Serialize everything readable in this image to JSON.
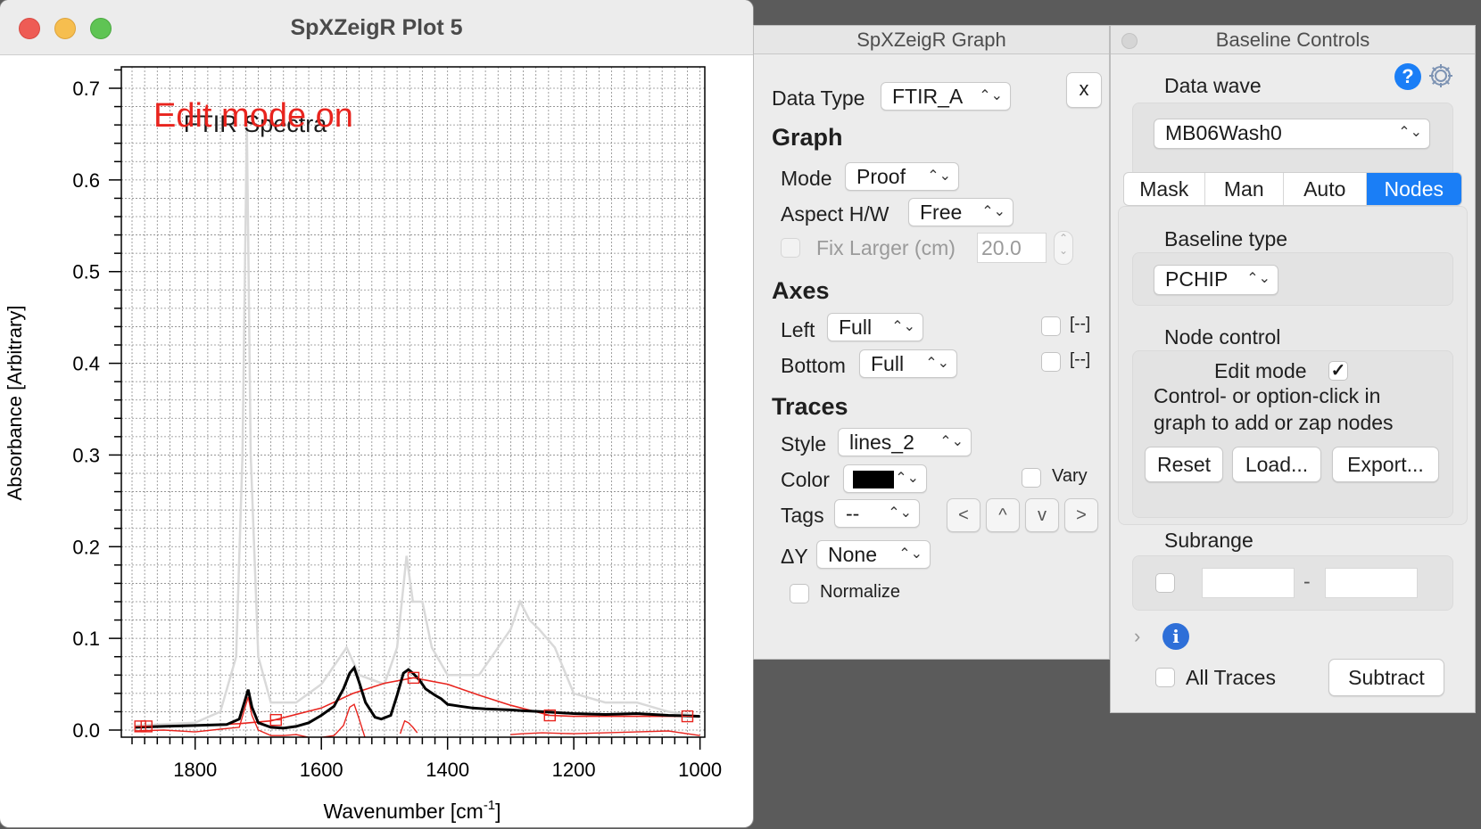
{
  "plot_window": {
    "title": "SpXZeigR Plot 5",
    "edit_mode_text": "Edit mode on",
    "plot_title": "FTIR Spectra",
    "colors": {
      "edit_text": "#e8241e",
      "trace": "#000000",
      "baseline": "#e8241e",
      "ghost": "#d9d9d9"
    },
    "chart_data": {
      "type": "line",
      "title": "FTIR Spectra",
      "xlabel": "Wavenumber [cm",
      "xlabel_sup": "-1",
      "xlabel_tail": "]",
      "ylabel": "Absorbance [Arbitrary]",
      "xlim": [
        1900,
        1000
      ],
      "ylim": [
        -0.01,
        0.72
      ],
      "x_reversed": true,
      "grid": true,
      "x_ticks": [
        "1800",
        "1600",
        "1400",
        "1200",
        "1000"
      ],
      "y_ticks": [
        "0.0",
        "0.1",
        "0.2",
        "0.3",
        "0.4",
        "0.5",
        "0.6",
        "0.7"
      ],
      "series": [
        {
          "role": "ghost",
          "points": [
            [
              1895,
              0.005
            ],
            [
              1800,
              0.008
            ],
            [
              1760,
              0.02
            ],
            [
              1735,
              0.08
            ],
            [
              1725,
              0.3
            ],
            [
              1718,
              0.66
            ],
            [
              1712,
              0.3
            ],
            [
              1700,
              0.08
            ],
            [
              1680,
              0.03
            ],
            [
              1640,
              0.03
            ],
            [
              1600,
              0.05
            ],
            [
              1560,
              0.09
            ],
            [
              1540,
              0.06
            ],
            [
              1500,
              0.05
            ],
            [
              1480,
              0.09
            ],
            [
              1465,
              0.19
            ],
            [
              1455,
              0.14
            ],
            [
              1440,
              0.14
            ],
            [
              1425,
              0.09
            ],
            [
              1400,
              0.06
            ],
            [
              1350,
              0.06
            ],
            [
              1300,
              0.11
            ],
            [
              1285,
              0.14
            ],
            [
              1270,
              0.12
            ],
            [
              1255,
              0.11
            ],
            [
              1230,
              0.09
            ],
            [
              1200,
              0.04
            ],
            [
              1150,
              0.03
            ],
            [
              1100,
              0.03
            ],
            [
              1050,
              0.02
            ],
            [
              1000,
              0.015
            ]
          ]
        },
        {
          "role": "trace",
          "points": [
            [
              1895,
              0.003
            ],
            [
              1850,
              0.004
            ],
            [
              1800,
              0.005
            ],
            [
              1750,
              0.006
            ],
            [
              1730,
              0.012
            ],
            [
              1722,
              0.03
            ],
            [
              1716,
              0.044
            ],
            [
              1710,
              0.025
            ],
            [
              1700,
              0.008
            ],
            [
              1680,
              0.003
            ],
            [
              1660,
              0.002
            ],
            [
              1640,
              0.004
            ],
            [
              1620,
              0.008
            ],
            [
              1600,
              0.016
            ],
            [
              1580,
              0.026
            ],
            [
              1565,
              0.045
            ],
            [
              1555,
              0.062
            ],
            [
              1548,
              0.068
            ],
            [
              1540,
              0.052
            ],
            [
              1530,
              0.03
            ],
            [
              1515,
              0.014
            ],
            [
              1505,
              0.012
            ],
            [
              1490,
              0.016
            ],
            [
              1480,
              0.038
            ],
            [
              1470,
              0.062
            ],
            [
              1462,
              0.066
            ],
            [
              1455,
              0.062
            ],
            [
              1445,
              0.055
            ],
            [
              1435,
              0.045
            ],
            [
              1420,
              0.038
            ],
            [
              1410,
              0.034
            ],
            [
              1400,
              0.028
            ],
            [
              1380,
              0.026
            ],
            [
              1360,
              0.024
            ],
            [
              1340,
              0.023
            ],
            [
              1300,
              0.022
            ],
            [
              1280,
              0.021
            ],
            [
              1250,
              0.02
            ],
            [
              1200,
              0.018
            ],
            [
              1150,
              0.017
            ],
            [
              1100,
              0.018
            ],
            [
              1050,
              0.016
            ],
            [
              1000,
              0.015
            ]
          ]
        },
        {
          "role": "baseline",
          "points": [
            [
              1887,
              0.004
            ],
            [
              1800,
              0.005
            ],
            [
              1730,
              0.007
            ],
            [
              1680,
              0.01
            ],
            [
              1600,
              0.024
            ],
            [
              1550,
              0.04
            ],
            [
              1500,
              0.051
            ],
            [
              1454,
              0.057
            ],
            [
              1400,
              0.05
            ],
            [
              1350,
              0.038
            ],
            [
              1300,
              0.027
            ],
            [
              1238,
              0.016
            ],
            [
              1200,
              0.015
            ],
            [
              1150,
              0.015
            ],
            [
              1100,
              0.015
            ],
            [
              1020,
              0.015
            ]
          ]
        },
        {
          "role": "difference",
          "points": [
            [
              1895,
              -0.001
            ],
            [
              1850,
              0.0
            ],
            [
              1800,
              -0.002
            ],
            [
              1760,
              0.001
            ],
            [
              1730,
              0.003
            ],
            [
              1722,
              0.022
            ],
            [
              1716,
              0.036
            ],
            [
              1710,
              0.016
            ],
            [
              1700,
              0.0
            ],
            [
              1680,
              -0.006
            ],
            [
              1660,
              -0.006
            ],
            [
              1640,
              -0.005
            ],
            [
              1620,
              -0.008
            ],
            [
              1600,
              -0.008
            ],
            [
              1580,
              -0.006
            ],
            [
              1565,
              0.005
            ],
            [
              1555,
              0.025
            ],
            [
              1548,
              0.028
            ],
            [
              1540,
              0.012
            ],
            [
              1530,
              -0.01
            ],
            [
              1522,
              -0.012
            ]
          ]
        },
        {
          "role": "difference",
          "points": [
            [
              1475,
              -0.004
            ],
            [
              1468,
              0.01
            ],
            [
              1462,
              0.008
            ],
            [
              1455,
              0.003
            ],
            [
              1448,
              -0.003
            ]
          ]
        },
        {
          "role": "difference",
          "points": [
            [
              1300,
              -0.005
            ],
            [
              1280,
              -0.004
            ],
            [
              1250,
              -0.003
            ],
            [
              1200,
              -0.004
            ],
            [
              1150,
              -0.003
            ],
            [
              1100,
              -0.002
            ],
            [
              1050,
              -0.001
            ],
            [
              1000,
              -0.006
            ]
          ]
        }
      ],
      "nodes": [
        [
          1887,
          0.004
        ],
        [
          1877,
          0.004
        ],
        [
          1672,
          0.011
        ],
        [
          1454,
          0.057
        ],
        [
          1238,
          0.016
        ],
        [
          1020,
          0.015
        ]
      ]
    }
  },
  "graph_panel": {
    "title": "SpXZeigR Graph",
    "data_type_label": "Data Type",
    "data_type_value": "FTIR_A",
    "close_label": "x",
    "graph_header": "Graph",
    "mode_label": "Mode",
    "mode_value": "Proof",
    "aspect_label": "Aspect H/W",
    "aspect_value": "Free",
    "fix_larger_label": "Fix Larger (cm)",
    "fix_larger_value": "20.0",
    "axes_header": "Axes",
    "left_label": "Left",
    "left_value": "Full",
    "left_toggle_label": "[--]",
    "bottom_label": "Bottom",
    "bottom_value": "Full",
    "bottom_toggle_label": "[--]",
    "traces_header": "Traces",
    "style_label": "Style",
    "style_value": "lines_2",
    "color_label": "Color",
    "color_value": "#000000",
    "vary_label": "Vary",
    "tags_label": "Tags",
    "tags_value": "--",
    "nav_buttons": [
      "<",
      "^",
      "v",
      ">"
    ],
    "delta_y_label": "ΔY",
    "delta_y_value": "None",
    "normalize_label": "Normalize"
  },
  "baseline_panel": {
    "title": "Baseline Controls",
    "data_wave_label": "Data wave",
    "data_wave_value": "MB06Wash0",
    "tabs": [
      "Mask",
      "Man",
      "Auto",
      "Nodes"
    ],
    "active_tab": "Nodes",
    "baseline_type_label": "Baseline type",
    "baseline_type_value": "PCHIP",
    "node_control_label": "Node control",
    "edit_mode_label": "Edit mode",
    "edit_mode_checked": true,
    "help_line1": "Control- or option-click in",
    "help_line2": "graph to add or zap nodes",
    "reset_label": "Reset",
    "load_label": "Load...",
    "export_label": "Export...",
    "subrange_label": "Subrange",
    "subrange_separator": "-",
    "all_traces_label": "All Traces",
    "subtract_label": "Subtract",
    "accent_color": "#1a7ef6"
  }
}
